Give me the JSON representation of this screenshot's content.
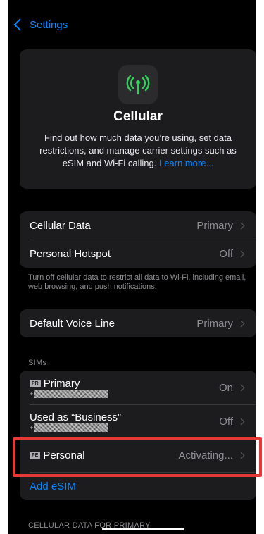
{
  "nav": {
    "back_label": "Settings"
  },
  "hero": {
    "title": "Cellular",
    "description": "Find out how much data you’re using, set data restrictions, and manage carrier settings such as eSIM and Wi‑Fi calling.",
    "learn_more": "Learn more...",
    "icon": "antenna-icon",
    "icon_color": "#30d158"
  },
  "group1": {
    "rows": [
      {
        "label": "Cellular Data",
        "value": "Primary"
      },
      {
        "label": "Personal Hotspot",
        "value": "Off"
      }
    ],
    "footnote": "Turn off cellular data to restrict all data to Wi-Fi, including email, web browsing, and push notifications."
  },
  "group2": {
    "rows": [
      {
        "label": "Default Voice Line",
        "value": "Primary"
      }
    ]
  },
  "sims": {
    "header": "SIMs",
    "items": [
      {
        "badge": "PR",
        "label": "Primary",
        "number_prefix": "+",
        "value": "On"
      },
      {
        "label": "Used as “Business”",
        "number_prefix": "+",
        "value": "Off"
      },
      {
        "badge": "PE",
        "label": "Personal",
        "value": "Activating..."
      }
    ],
    "add_esim": "Add eSIM"
  },
  "bottom_header": "CELLULAR DATA FOR PRIMARY",
  "colors": {
    "accent": "#0a84ff",
    "highlight": "#e53935",
    "background": "#000000",
    "card": "#1c1c1e"
  }
}
